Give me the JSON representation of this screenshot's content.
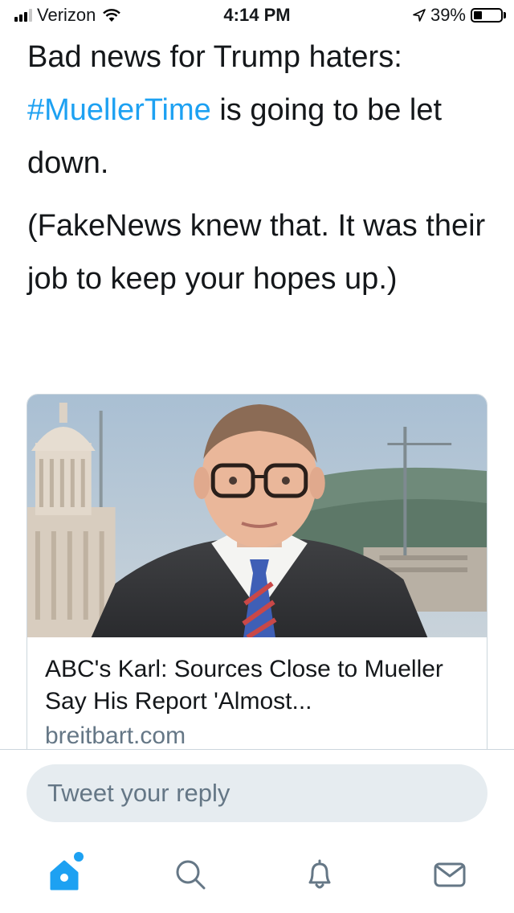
{
  "status_bar": {
    "carrier": "Verizon",
    "time": "4:14 PM",
    "battery_percent": "39%",
    "battery_level": 0.39,
    "icons": [
      "signal-icon",
      "wifi-icon",
      "location-arrow-icon",
      "battery-icon"
    ]
  },
  "tweet": {
    "line1_pre": "Bad news for Trump haters: ",
    "hashtag": "#MuellerTime",
    "line1_post": " is going to be let down.",
    "paragraph2": "(FakeNews knew that. It was their job to keep your hopes up.)"
  },
  "card": {
    "title": "ABC's Karl: Sources Close to Mueller Say His Report 'Almost...",
    "domain": "breitbart.com"
  },
  "reply": {
    "placeholder": "Tweet your reply"
  },
  "tabs": [
    {
      "name": "home",
      "icon": "home-icon",
      "active": true
    },
    {
      "name": "search",
      "icon": "search-icon",
      "active": false
    },
    {
      "name": "notifications",
      "icon": "bell-icon",
      "active": false
    },
    {
      "name": "messages",
      "icon": "mail-icon",
      "active": false
    }
  ],
  "colors": {
    "accent": "#1da1f2",
    "text": "#14171a",
    "secondary": "#657786",
    "border": "#ccd6dd",
    "input_bg": "#e6ecf0"
  }
}
